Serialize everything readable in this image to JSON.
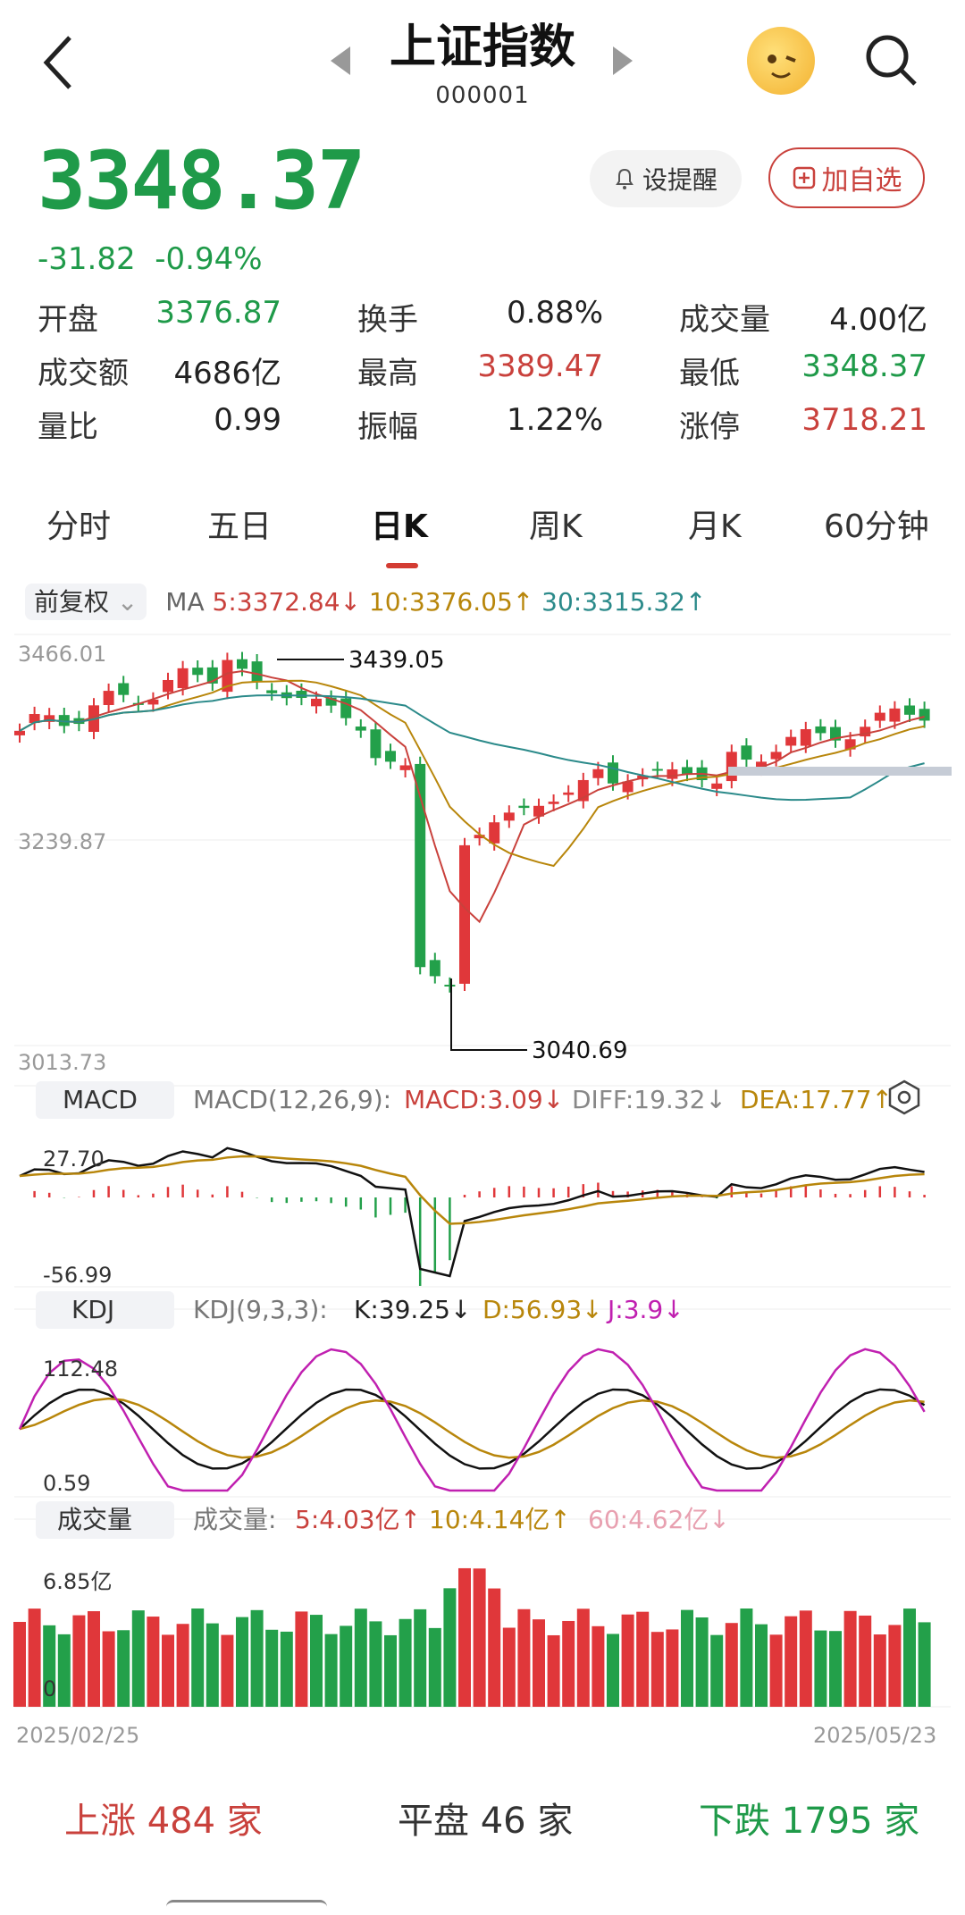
{
  "header": {
    "title": "上证指数",
    "code": "000001"
  },
  "quote": {
    "price": "3348.37",
    "change": "-31.82",
    "change_pct": "-0.94%"
  },
  "buttons": {
    "alert": "设提醒",
    "favorite": "加自选"
  },
  "stats": [
    {
      "label": "开盘",
      "value": "3376.87",
      "color": "#1f9a49"
    },
    {
      "label": "换手",
      "value": "0.88%",
      "color": "#222222"
    },
    {
      "label": "成交量",
      "value": "4.00亿",
      "color": "#222222"
    },
    {
      "label": "成交额",
      "value": "4686亿",
      "color": "#222222"
    },
    {
      "label": "最高",
      "value": "3389.47",
      "color": "#c9413c"
    },
    {
      "label": "最低",
      "value": "3348.37",
      "color": "#1f9a49"
    },
    {
      "label": "量比",
      "value": "0.99",
      "color": "#222222"
    },
    {
      "label": "振幅",
      "value": "1.22%",
      "color": "#222222"
    },
    {
      "label": "涨停",
      "value": "3718.21",
      "color": "#c9413c"
    }
  ],
  "tabs": [
    "分时",
    "五日",
    "日K",
    "周K",
    "月K",
    "60分钟"
  ],
  "active_tab": "日K",
  "ma_bar": {
    "adjust": "前复权",
    "label": "MA",
    "ma5": "5:3372.84↓",
    "ma10": "10:3376.05↑",
    "ma30": "30:3315.32↑"
  },
  "kline": {
    "y_top": "3466.01",
    "y_mid": "3239.87",
    "y_bot": "3013.73",
    "high_label": "3439.05",
    "low_label": "3040.69"
  },
  "macd_bar": {
    "name": "MACD",
    "params": "MACD(12,26,9):",
    "macd": "MACD:3.09↓",
    "diff": "DIFF:19.32↓",
    "dea": "DEA:17.77↑",
    "y_top": "27.70",
    "y_bot": "-56.99"
  },
  "kdj_bar": {
    "name": "KDJ",
    "params": "KDJ(9,3,3):",
    "k": "K:39.25↓",
    "d": "D:56.93↓",
    "j": "J:3.9↓",
    "y_top": "112.48",
    "y_bot": "0.59"
  },
  "vol_bar": {
    "name": "成交量",
    "label": "成交量:",
    "v5": "5:4.03亿↑",
    "v10": "10:4.14亿↑",
    "v60": "60:4.62亿↓",
    "y_top": "6.85亿",
    "y_bot": "0"
  },
  "dates": {
    "start": "2025/02/25",
    "end": "2025/05/23"
  },
  "breadth": {
    "up_label": "上涨",
    "up_count": "484",
    "up_unit": "家",
    "flat_label": "平盘",
    "flat_count": "46",
    "flat_unit": "家",
    "down_label": "下跌",
    "down_count": "1795",
    "down_unit": "家"
  },
  "colors": {
    "up": "#e0373a",
    "down": "#23a04a",
    "ma5": "#c9413c",
    "ma10": "#b8860b",
    "ma30": "#2b8a8a",
    "macd_dea": "#b8860b",
    "kdj_j": "#c020b0"
  }
}
